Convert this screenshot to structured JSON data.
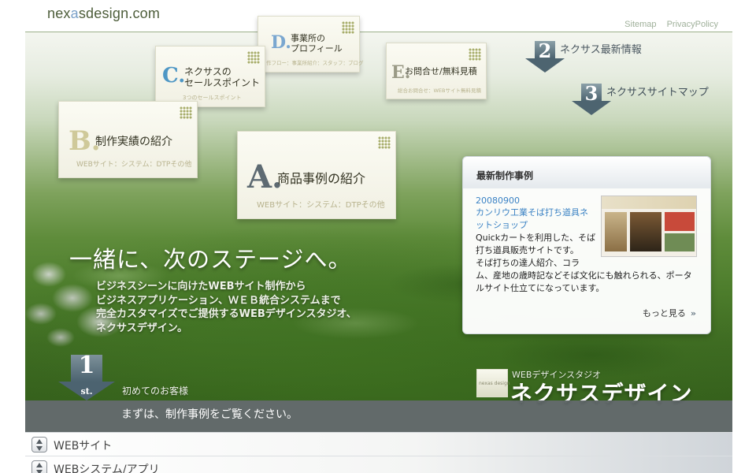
{
  "header": {
    "logo": {
      "pre": "nex",
      "accent": "a",
      "post": "sdesign.com"
    },
    "links": [
      "Sitemap",
      "PrivacyPolicy"
    ]
  },
  "cards": {
    "a": {
      "letter": "A.",
      "title": "商品事例の紹介",
      "sub": "WEBサイト：システム：DTPその他"
    },
    "b": {
      "letter": "B.",
      "title": "制作実績の紹介",
      "sub": "WEBサイト：システム：DTPその他"
    },
    "c": {
      "letter": "C.",
      "title_line1": "ネクサスの",
      "title_line2": "セールスポイント",
      "sub": "3つのセールスポイント"
    },
    "d": {
      "letter": "D.",
      "title_line1": "事業所の",
      "title_line2": "プロフィール",
      "sub": "作フロー：事業所紹介：スタッフ：ブログ"
    },
    "e": {
      "letter": "E.",
      "title": "お問合せ/無料見積",
      "sub": "総合お問合せ：WEBサイト無料見積"
    }
  },
  "markers": {
    "m2": {
      "num": "2",
      "label": "ネクサス最新情報"
    },
    "m3": {
      "num": "3",
      "label": "ネクサスサイトマップ"
    },
    "m1": {
      "num": "1",
      "st": "st.",
      "label": "初めてのお客様"
    }
  },
  "hero": {
    "headline": "一緒に、次のステージへ。",
    "intro": [
      "ビジネスシーンに向けたWEBサイト制作から",
      "ビジネスアプリケーション、ＷＥＢ統合システムまで",
      "完全カスタマイズでご提供するWEBデザインスタジオ、",
      "ネクサスデザイン。"
    ]
  },
  "news": {
    "title": "最新制作事例",
    "date": "20080900",
    "link_line1": "カンリウ工業そば打ち道具ネ",
    "link_line2": "ットショップ",
    "body": [
      "Quickカートを利用した、そば",
      "打ち道具販売サイトです。",
      "そば打ちの達人紹介、コラ",
      "ム、産地の歳時記などそば文化にも触れられる、ポータ",
      "ルサイト仕立てになっています。"
    ],
    "more": "もっと見る",
    "more_icon": "»"
  },
  "brand": {
    "box_text": "nexas design",
    "sub": "WEBデザインスタジオ",
    "name": "ネクサスデザイン"
  },
  "band": {
    "text": "まずは、制作事例をご覧ください。"
  },
  "accordion": [
    {
      "label": "WEBサイト"
    },
    {
      "label": "WEBシステム/アプリ"
    }
  ]
}
